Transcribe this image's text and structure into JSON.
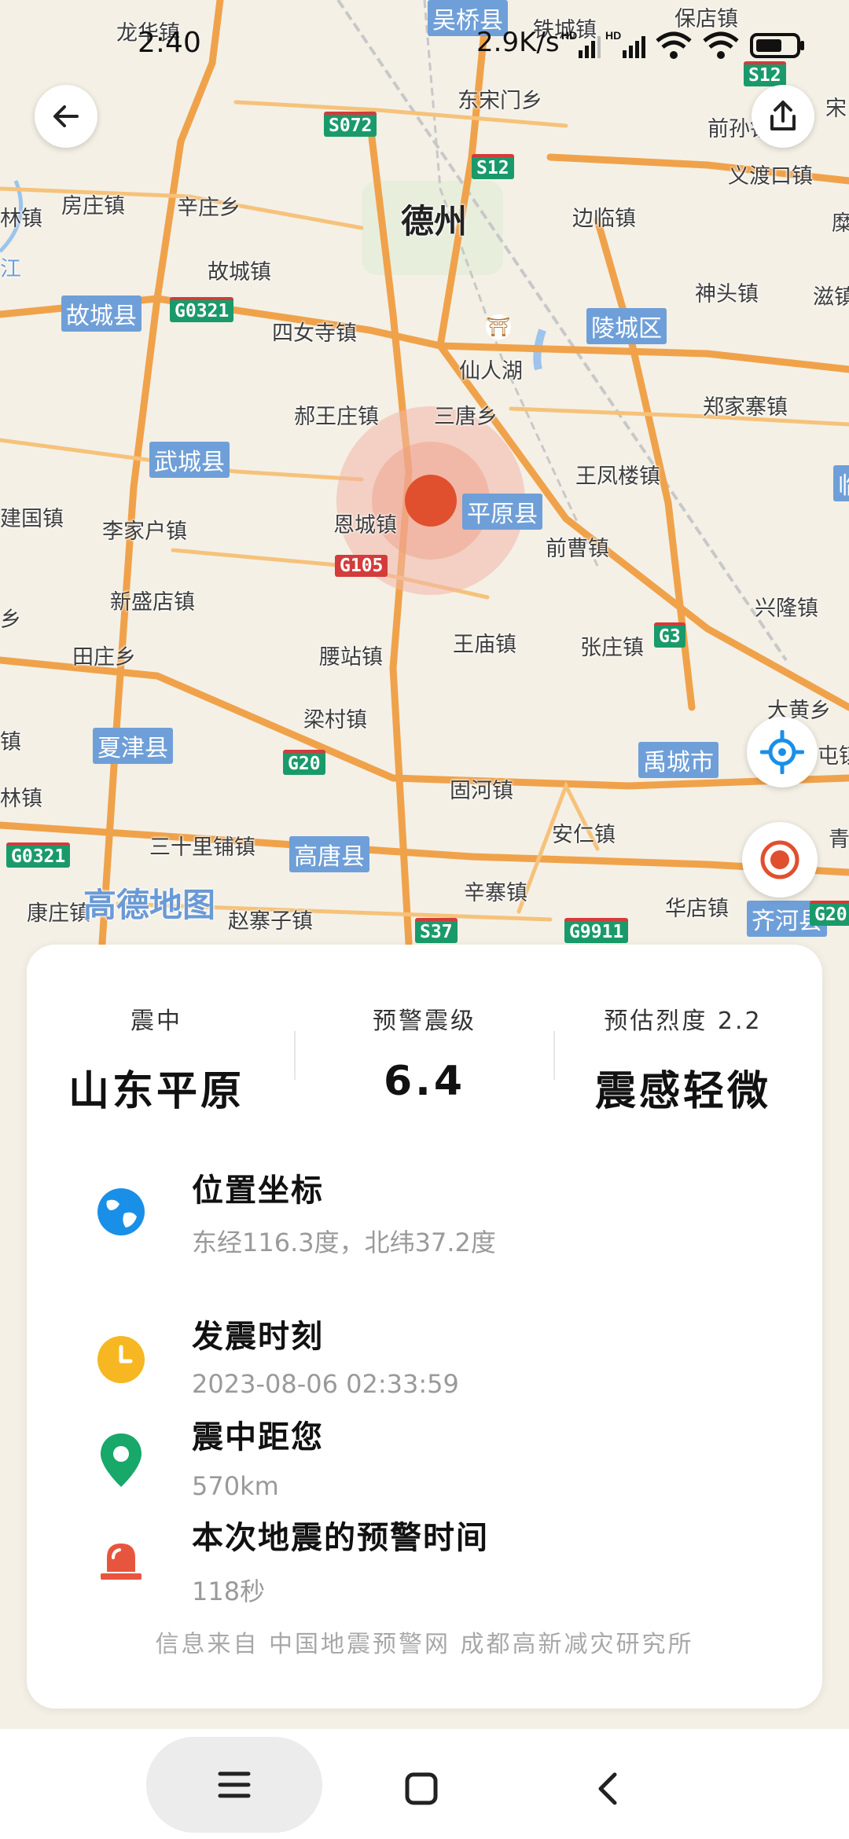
{
  "status_bar": {
    "time": "2:40",
    "net_speed": "2.9K/s",
    "signal1_label": "HD",
    "signal2_label": "HD"
  },
  "map": {
    "logo": "高德地图",
    "labels": {
      "longhuazhen": "龙华镇",
      "houqiaozhen": "吴桥县",
      "tiechengzhen": "铁城镇",
      "baodianzhen": "保店镇",
      "dongsongmenxiang": "东宋门乡",
      "qiancheng": "前孙镇",
      "song": "宋",
      "fangzhuangzhen": "房庄镇",
      "xinzhuangxiang": "辛庄乡",
      "dezhou": "德州",
      "bianlinzhen": "边临镇",
      "yiduzhen": "义渡口镇",
      "mi": "糜",
      "linzhen_left": "林镇",
      "jiang": "江",
      "guchengzhen": "故城镇",
      "shentouzhen": "神头镇",
      "zibo": "滋镇",
      "guchengxian": "故城县",
      "sinusizhen": "四女寺镇",
      "lingchengqu": "陵城区",
      "xianrenhu": "仙人湖",
      "zhengjiazhai": "郑家寨镇",
      "haowangzhuang": "郝王庄镇",
      "sanqiangxiang": "三唐乡",
      "wuchengxian": "武城县",
      "wangfenglou": "王凤楼镇",
      "lin_right": "临",
      "jianguozhen": "建国镇",
      "lijiahu": "李家户镇",
      "enchengzhen": "恩城镇",
      "pingyuanxian": "平原县",
      "qiancao": "前曹镇",
      "xinshengdian": "新盛店镇",
      "xinglongzhen": "兴隆镇",
      "xiang_left": "乡",
      "tianzhuangxiang": "田庄乡",
      "yaozhanzhen": "腰站镇",
      "wangmiaozhen": "王庙镇",
      "zhangzhuangzhen": "张庄镇",
      "xiajinxian": "夏津县",
      "liangcunzhen": "梁村镇",
      "yuchengshi": "禹城市",
      "dahuangxiang": "大黄乡",
      "zhen_left": "镇",
      "tun_right": "屯镇",
      "guhezhen": "固河镇",
      "anrenzhen": "安仁镇",
      "lin_left": "林镇",
      "sanshilipu": "三十里铺镇",
      "gaotangxian": "高唐县",
      "qing_right": "青",
      "kangzhuang": "康庄镇",
      "zhaozhai": "赵寨子镇",
      "xinzhai": "辛寨镇",
      "huadian": "华店镇",
      "qihexian": "齐河县"
    },
    "shields": {
      "s072": "S072",
      "s12a": "S12",
      "s12b": "S12",
      "g0321a": "G0321",
      "g105": "G105",
      "g3": "G3",
      "g20a": "G20",
      "g0321b": "G0321",
      "s37": "S37",
      "g9911": "G9911",
      "g20b": "G20"
    }
  },
  "panel": {
    "stats": [
      {
        "caption": "震中",
        "value": "山东平原"
      },
      {
        "caption": "预警震级",
        "value": "6.4"
      },
      {
        "caption": "预估烈度 2.2",
        "value": "震感轻微"
      }
    ],
    "location": {
      "title": "位置坐标",
      "value": "东经116.3度，北纬37.2度"
    },
    "time": {
      "title": "发震时刻",
      "value": "2023-08-06 02:33:59"
    },
    "distance": {
      "title": "震中距您",
      "value": "570km"
    },
    "warning": {
      "title": "本次地震的预警时间",
      "value": "118秒"
    },
    "source": "信息来自 中国地震预警网 成都高新减灾研究所"
  },
  "colors": {
    "epicenter": "#e0502f",
    "accent_blue": "#1a8fe8",
    "clock_yellow": "#f7b722",
    "pin_green": "#17a86a",
    "siren_red": "#e8553f"
  },
  "icons": {
    "back": "arrow-left-icon",
    "share": "share-icon",
    "locate": "crosshair-icon",
    "target": "target-icon",
    "globe": "globe-icon",
    "clock": "clock-icon",
    "pin": "map-pin-icon",
    "siren": "siren-icon"
  }
}
